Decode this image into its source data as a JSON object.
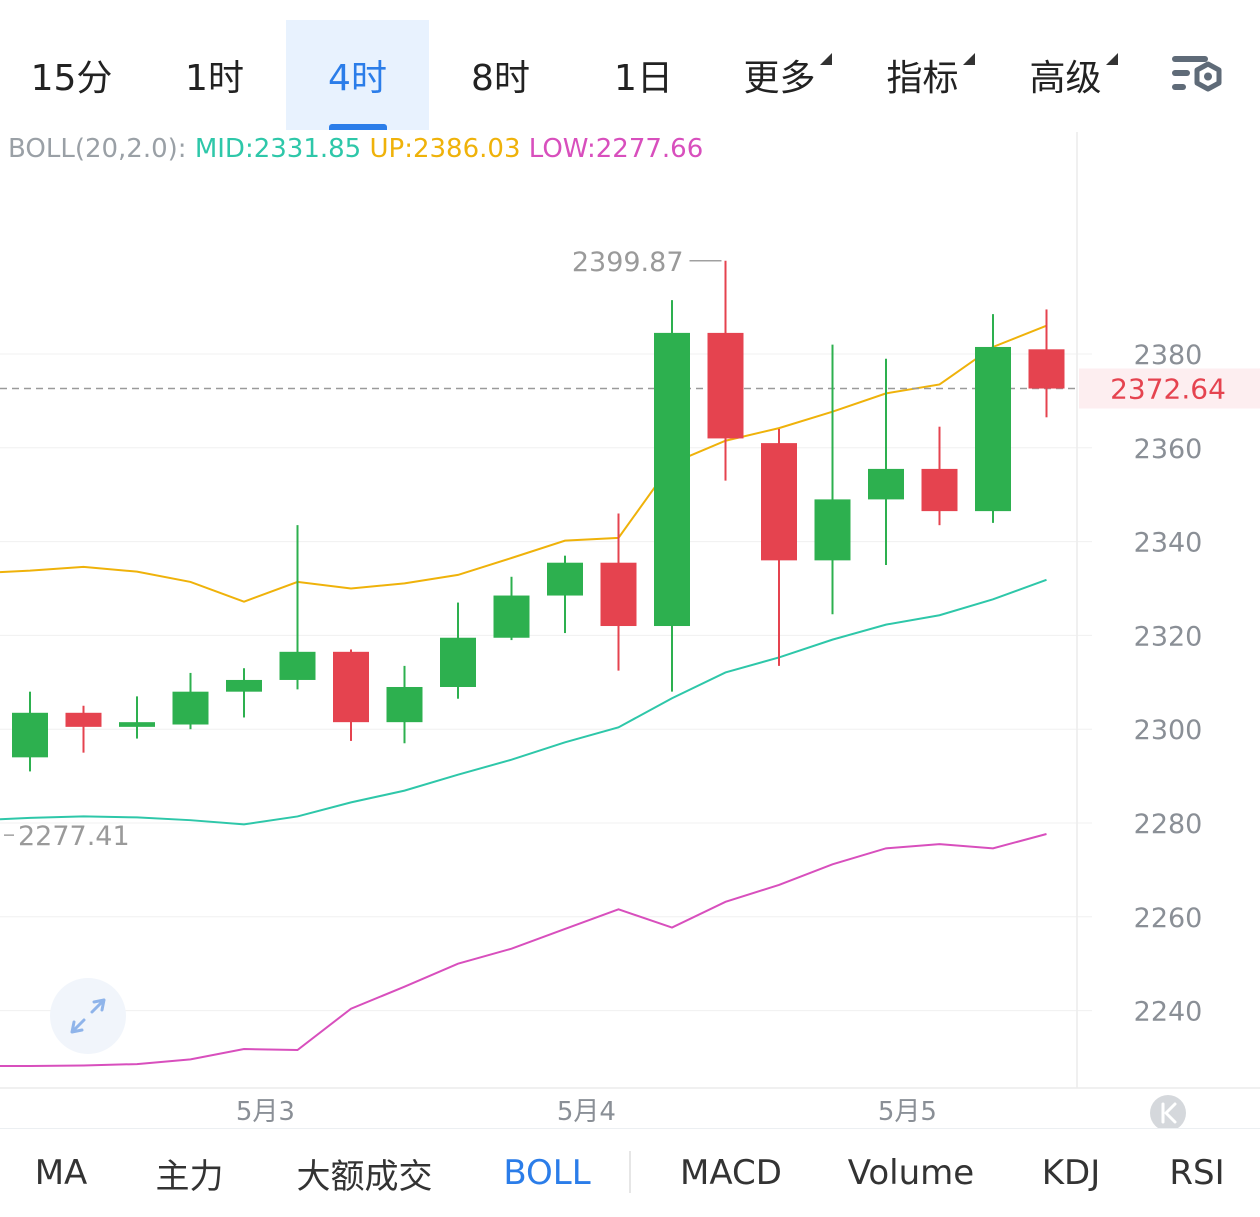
{
  "timeframe_tabs": [
    {
      "label": "15分",
      "active": false,
      "dropdown": false
    },
    {
      "label": "1时",
      "active": false,
      "dropdown": false
    },
    {
      "label": "4时",
      "active": true,
      "dropdown": false
    },
    {
      "label": "8时",
      "active": false,
      "dropdown": false
    },
    {
      "label": "1日",
      "active": false,
      "dropdown": false
    },
    {
      "label": "更多",
      "active": false,
      "dropdown": true
    },
    {
      "label": "指标",
      "active": false,
      "dropdown": true
    },
    {
      "label": "高级",
      "active": false,
      "dropdown": true
    }
  ],
  "settings_icon": "chart-settings-icon",
  "legend": {
    "prefix": "BOLL(20,2.0):",
    "mid": "MID:2331.85",
    "up": "UP:2386.03",
    "low": "LOW:2277.66"
  },
  "colors": {
    "up_candle": "#2db04f",
    "down_candle": "#e5434f",
    "mid_line": "#2ec7a9",
    "up_line": "#efb20a",
    "low_line": "#d84fbd",
    "accent": "#2b7de9",
    "price_tag": "#e5434f"
  },
  "chart_data": {
    "type": "candlestick",
    "y_axis_ticks": [
      2380,
      2360,
      2340,
      2320,
      2300,
      2280,
      2260,
      2240
    ],
    "y_axis_tick_labels": [
      "2380",
      "2360",
      "2340",
      "2320",
      "2300",
      "2280",
      "2260",
      "2240"
    ],
    "x_axis_labels": [
      {
        "label": "5月3",
        "index": 4.4
      },
      {
        "label": "5月4",
        "index": 10.4
      },
      {
        "label": "5月5",
        "index": 16.4
      }
    ],
    "candles": [
      {
        "open": 2294.0,
        "high": 2308.0,
        "low": 2291.0,
        "close": 2303.5
      },
      {
        "open": 2303.5,
        "high": 2305.0,
        "low": 2295.0,
        "close": 2300.5
      },
      {
        "open": 2300.5,
        "high": 2307.0,
        "low": 2298.0,
        "close": 2301.5
      },
      {
        "open": 2301.0,
        "high": 2312.0,
        "low": 2300.0,
        "close": 2308.0
      },
      {
        "open": 2308.0,
        "high": 2313.0,
        "low": 2302.5,
        "close": 2310.5
      },
      {
        "open": 2310.5,
        "high": 2343.5,
        "low": 2308.5,
        "close": 2316.5
      },
      {
        "open": 2316.5,
        "high": 2317.0,
        "low": 2297.5,
        "close": 2301.5
      },
      {
        "open": 2301.5,
        "high": 2313.5,
        "low": 2297.0,
        "close": 2309.0
      },
      {
        "open": 2309.0,
        "high": 2327.0,
        "low": 2306.5,
        "close": 2319.5
      },
      {
        "open": 2319.5,
        "high": 2332.5,
        "low": 2319.0,
        "close": 2328.5
      },
      {
        "open": 2328.5,
        "high": 2337.0,
        "low": 2320.5,
        "close": 2335.5
      },
      {
        "open": 2335.5,
        "high": 2346.0,
        "low": 2312.5,
        "close": 2322.0
      },
      {
        "open": 2322.0,
        "high": 2391.5,
        "low": 2308.0,
        "close": 2384.5
      },
      {
        "open": 2384.5,
        "high": 2399.87,
        "low": 2353.0,
        "close": 2362.0
      },
      {
        "open": 2361.0,
        "high": 2364.0,
        "low": 2313.5,
        "close": 2336.0
      },
      {
        "open": 2336.0,
        "high": 2382.0,
        "low": 2324.5,
        "close": 2349.0
      },
      {
        "open": 2349.0,
        "high": 2379.0,
        "low": 2335.0,
        "close": 2355.5
      },
      {
        "open": 2355.5,
        "high": 2364.5,
        "low": 2343.5,
        "close": 2346.5
      },
      {
        "open": 2346.5,
        "high": 2388.5,
        "low": 2344.0,
        "close": 2381.5
      },
      {
        "open": 2381.0,
        "high": 2389.5,
        "low": 2366.5,
        "close": 2372.64
      }
    ],
    "series": [
      {
        "name": "UP",
        "values": [
          2333.5,
          2333.8,
          2334.6,
          2333.6,
          2331.4,
          2327.2,
          2331.4,
          2330.0,
          2331.1,
          2332.9,
          2336.5,
          2340.2,
          2340.8,
          2356.7,
          2361.5,
          2364.2,
          2367.7,
          2371.6,
          2373.5,
          2381.5,
          2386.03
        ]
      },
      {
        "name": "MID",
        "values": [
          2280.8,
          2281.1,
          2281.4,
          2281.2,
          2280.6,
          2279.7,
          2281.4,
          2284.4,
          2286.9,
          2290.3,
          2293.5,
          2297.2,
          2300.4,
          2306.6,
          2312.1,
          2315.3,
          2319.1,
          2322.3,
          2324.3,
          2327.7,
          2331.85
        ]
      },
      {
        "name": "LOW",
        "values": [
          2228.2,
          2228.2,
          2228.3,
          2228.6,
          2229.6,
          2231.8,
          2231.6,
          2240.4,
          2245.1,
          2250.0,
          2253.2,
          2257.4,
          2261.6,
          2257.7,
          2263.2,
          2266.8,
          2271.2,
          2274.6,
          2275.5,
          2274.6,
          2277.66
        ]
      }
    ],
    "annotations": [
      {
        "text": "2399.87",
        "candle": 13,
        "value": 2399.87,
        "side": "left"
      },
      {
        "text": "2277.41",
        "candle": 0,
        "value": 2277.41,
        "side": "right"
      }
    ],
    "last_price": {
      "value": 2372.64,
      "label": "2372.64"
    },
    "scroll_to_latest_icon": "scroll-to-latest-icon",
    "expand_icon": "expand-icon"
  },
  "indicator_tabs": [
    {
      "label": "MA",
      "active": false
    },
    {
      "label": "主力",
      "active": false
    },
    {
      "label": "大额成交",
      "active": false
    },
    {
      "label": "BOLL",
      "active": true
    },
    {
      "label": "MACD",
      "active": false
    },
    {
      "label": "Volume",
      "active": false
    },
    {
      "label": "KDJ",
      "active": false
    },
    {
      "label": "RSI",
      "active": false
    }
  ]
}
